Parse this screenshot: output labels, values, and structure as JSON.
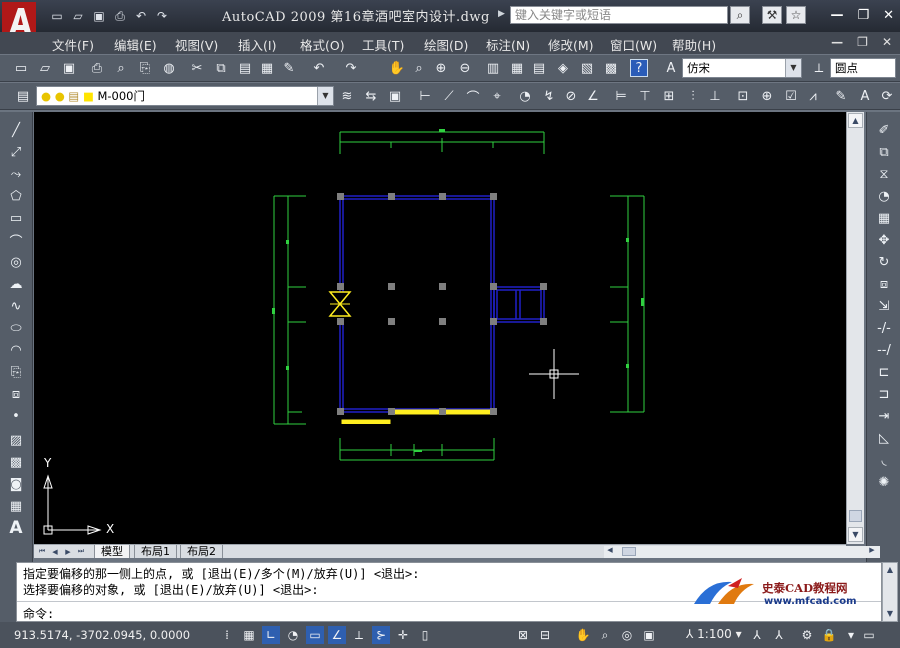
{
  "titlebar": {
    "app_title": "AutoCAD  2009  第16章酒吧室内设计.dwg",
    "search_placeholder": "键入关键字或短语",
    "window_buttons": {
      "minimize": "—",
      "restore": "❐",
      "close": "✕"
    }
  },
  "quick_access": [
    "new-icon",
    "open-icon",
    "save-icon",
    "print-icon",
    "undo-icon",
    "redo-icon"
  ],
  "menu": {
    "items": [
      "文件(F)",
      "编辑(E)",
      "视图(V)",
      "插入(I)",
      "格式(O)",
      "工具(T)",
      "绘图(D)",
      "标注(N)",
      "修改(M)",
      "窗口(W)",
      "帮助(H)"
    ],
    "mdi_buttons": {
      "minimize": "—",
      "restore": "❐",
      "close": "✕"
    }
  },
  "toolbar": {
    "text_style_font": "仿宋",
    "dim_style_name": "圆点",
    "layer_name": "M-000门"
  },
  "drawing": {
    "ucs_y_label": "Y",
    "ucs_x_label": "X",
    "colors": {
      "background": "#000000",
      "walls": "#2020c8",
      "dimensions": "#30d040",
      "highlight": "#ffee20",
      "grips": "#7f7f7f",
      "crosshair": "#ffffff"
    }
  },
  "layout_tabs": [
    "模型",
    "布局1",
    "布局2"
  ],
  "command": {
    "history_line_1": "指定要偏移的那一侧上的点, 或 [退出(E)/多个(M)/放弃(U)] <退出>:",
    "history_line_2": "选择要偏移的对象, 或 [退出(E)/放弃(U)] <退出>:",
    "prompt": "命令:"
  },
  "watermark": {
    "title": "史泰CAD教程网",
    "url": "www.mfcad.com"
  },
  "status": {
    "coordinates": "913.5174,   -3702.0945, 0.0000",
    "annotation_scale": "1:100"
  }
}
